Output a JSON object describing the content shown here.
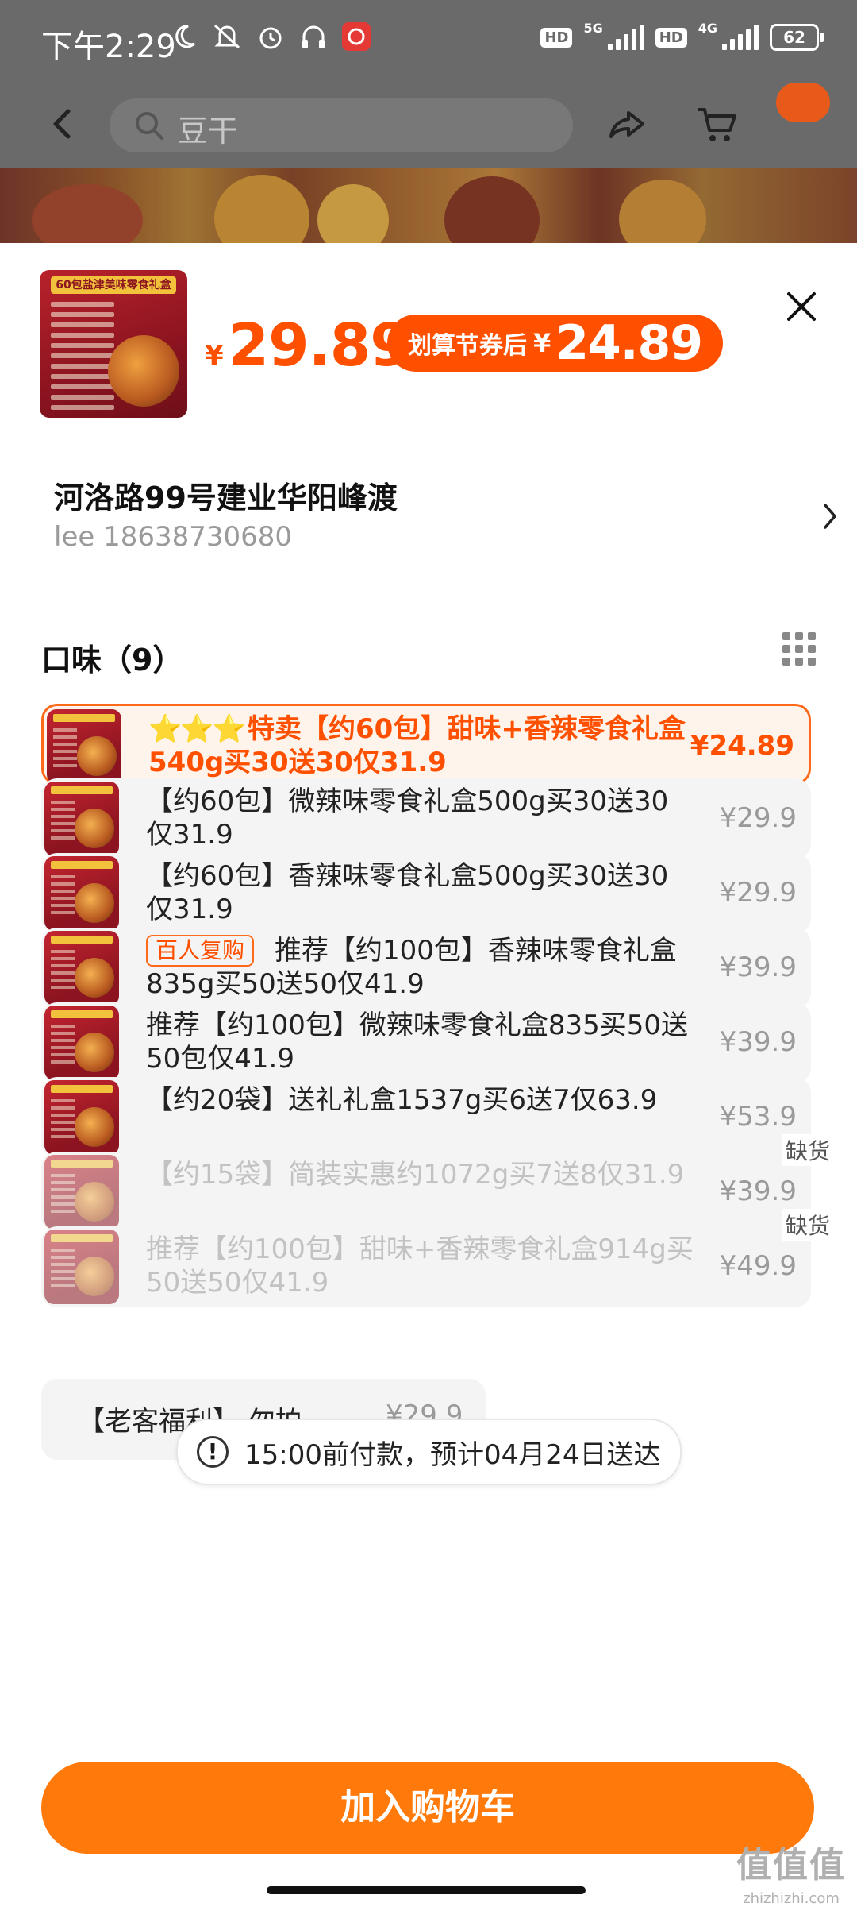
{
  "status_bar": {
    "time": "下午2:29",
    "battery": "62",
    "hd1": "HD",
    "net1": "5G",
    "hd2": "HD",
    "net2": "4G"
  },
  "nav": {
    "search_text": "豆干"
  },
  "product": {
    "price_symbol": "¥",
    "price": "29.89",
    "coupon_label": "划算节券后",
    "coupon_symbol": "¥",
    "coupon_price": "24.89",
    "image_tag": "60包盐津美味零食礼盒"
  },
  "address": {
    "title": "河洛路99号建业华阳峰渡",
    "contact": "lee 18638730680"
  },
  "flavor": {
    "heading": "口味（9）"
  },
  "options": [
    {
      "stars": "⭐⭐⭐",
      "name": "特卖【约60包】甜味+香辣零食礼盒540g买30送30仅31.9",
      "price": "¥24.89",
      "selected": true,
      "sold_out": false
    },
    {
      "name": "【约60包】微辣味零食礼盒500g买30送30仅31.9",
      "price": "¥29.9",
      "selected": false,
      "sold_out": false
    },
    {
      "name": "【约60包】香辣味零食礼盒500g买30送30仅31.9",
      "price": "¥29.9",
      "selected": false,
      "sold_out": false
    },
    {
      "badge": "百人复购",
      "name": "推荐【约100包】香辣味零食礼盒835g买50送50仅41.9",
      "price": "¥39.9",
      "selected": false,
      "sold_out": false
    },
    {
      "name": "推荐【约100包】微辣味零食礼盒835买50送50包仅41.9",
      "price": "¥39.9",
      "selected": false,
      "sold_out": false
    },
    {
      "name": "【约20袋】送礼礼盒1537g买6送7仅63.9",
      "price": "¥53.9",
      "selected": false,
      "sold_out": false
    },
    {
      "name": "【约15袋】简装实惠约1072g买7送8仅31.9",
      "price": "¥39.9",
      "selected": false,
      "sold_out": true,
      "sold_out_label": "缺货"
    },
    {
      "name": "推荐【约100包】甜味+香辣零食礼盒914g买50送50仅41.9",
      "price": "¥49.9",
      "selected": false,
      "sold_out": true,
      "sold_out_label": "缺货"
    }
  ],
  "partial_option": {
    "name": "【老客福利】 勿拍",
    "price": "¥29.9"
  },
  "notice": {
    "icon": "!",
    "text": "15:00前付款，预计04月24日送达"
  },
  "add_to_cart": "加入购物车",
  "watermark": {
    "logo": "值值值",
    "url": "zhizhizhi.com"
  },
  "colors": {
    "accent": "#ff5000",
    "button": "#ff7a0a",
    "selected_bg": "#fff4ec"
  }
}
